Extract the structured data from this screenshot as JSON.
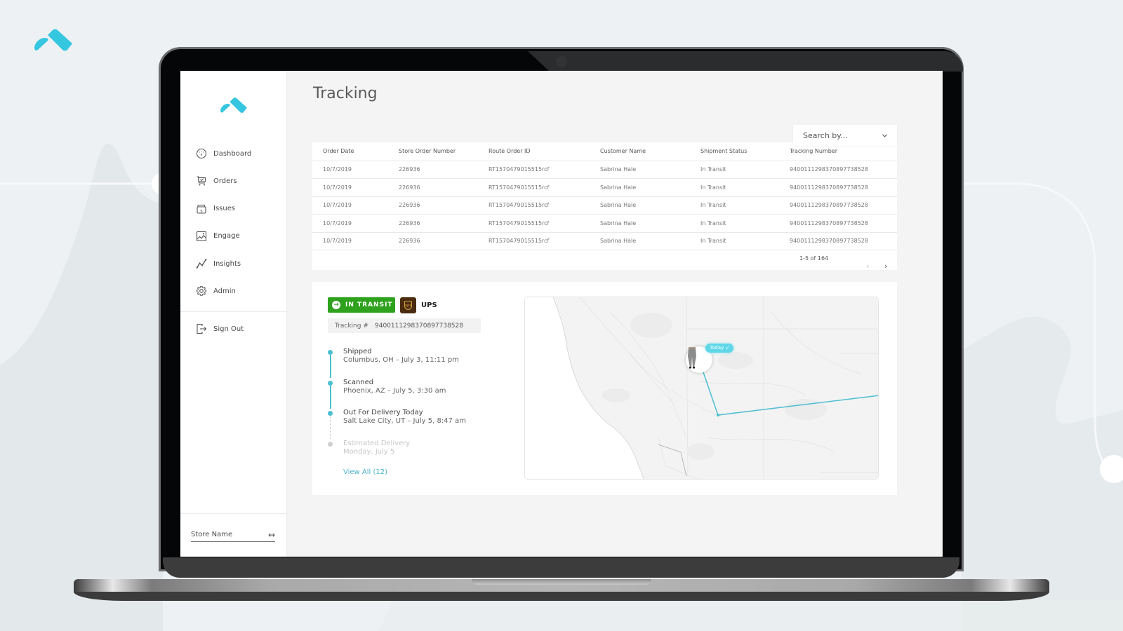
{
  "app": {
    "brand_color": "#35c6e0",
    "page_title": "Tracking"
  },
  "sidebar": {
    "items": [
      {
        "label": "Dashboard",
        "icon": "dashboard-gauge-icon"
      },
      {
        "label": "Orders",
        "icon": "cart-icon"
      },
      {
        "label": "Issues",
        "icon": "dollar-folder-icon"
      },
      {
        "label": "Engage",
        "icon": "image-icon"
      },
      {
        "label": "Insights",
        "icon": "line-chart-icon"
      },
      {
        "label": "Admin",
        "icon": "gear-icon"
      }
    ],
    "sign_out": "Sign Out",
    "store_name": "Store Name",
    "store_switch_icon": "↔"
  },
  "search": {
    "placeholder": "Search by..."
  },
  "table": {
    "columns": [
      "Order Date",
      "Store Order Number",
      "Route Order ID",
      "Customer Name",
      "Shipment Status",
      "Tracking Number"
    ],
    "rows": [
      [
        "10/7/2019",
        "226936",
        "RT1570479015515rcf",
        "Sabrina Hale",
        "In Transit",
        "9400111298370897738528"
      ],
      [
        "10/7/2019",
        "226936",
        "RT1570479015515rcf",
        "Sabrina Hale",
        "In Transit",
        "9400111298370897738528"
      ],
      [
        "10/7/2019",
        "226936",
        "RT1570479015515rcf",
        "Sabrina Hale",
        "In Transit",
        "9400111298370897738528"
      ],
      [
        "10/7/2019",
        "226936",
        "RT1570479015515rcf",
        "Sabrina Hale",
        "In Transit",
        "9400111298370897738528"
      ],
      [
        "10/7/2019",
        "226936",
        "RT1570479015515rcf",
        "Sabrina Hale",
        "In Transit",
        "9400111298370897738528"
      ]
    ],
    "pagination": "1-5 of 164",
    "prev_icon": "‹",
    "next_icon": "›"
  },
  "detail": {
    "status": "IN TRANSIT",
    "status_color": "#2ea21d",
    "carrier": "UPS",
    "carrier_logo_text": "ups",
    "tracking_label": "Tracking #",
    "tracking_number": "9400111298370897738528",
    "timeline": [
      {
        "title": "Shipped",
        "subtitle": "Columbus, OH  –  July 3, 11:11 pm",
        "state": "done"
      },
      {
        "title": "Scanned",
        "subtitle": "Phoenix, AZ  –  July 5, 3:30 am",
        "state": "done"
      },
      {
        "title": "Out For Delivery Today",
        "subtitle": "Salt Lake City, UT  –  July 5, 8:47 am",
        "state": "current"
      },
      {
        "title": "Estimated Delivery",
        "subtitle": "Monday, July 5",
        "state": "future"
      }
    ],
    "view_all": "View All (12)",
    "map": {
      "badge": "Today",
      "route_color": "#4cbfd1"
    }
  }
}
